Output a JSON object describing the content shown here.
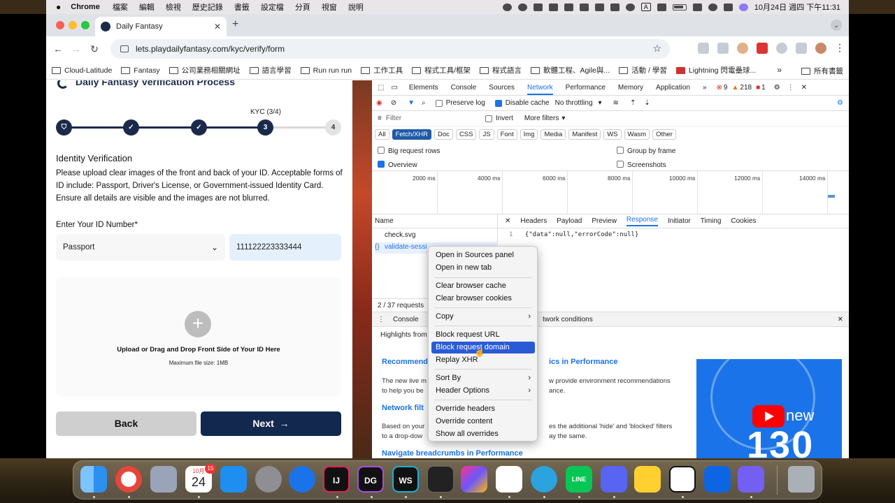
{
  "menubar": {
    "app": "Chrome",
    "items": [
      "檔案",
      "編輯",
      "檢視",
      "歷史記錄",
      "書籤",
      "設定檔",
      "分頁",
      "視窗",
      "說明"
    ],
    "datetime": "10月24日 週四 下午11:31",
    "input_mode": "A"
  },
  "browser": {
    "tab_title": "Daily Fantasy",
    "url": "lets.playdailyfantasy.com/kyc/verify/form",
    "bookmarks": [
      "Cloud-Latitude",
      "Fantasy",
      "公司業務相關網址",
      "語言學習",
      "Run run run",
      "工作工具",
      "程式工具/框架",
      "程式語言",
      "軟體工程、Agile與...",
      "活動 / 學習",
      "Lightning 閃電壘球..."
    ],
    "bookmarks_more": "»",
    "all_bookmarks": "所有書籤"
  },
  "page": {
    "title": "Daily Fantasy Verification Process",
    "kyc_progress": "KYC (3/4)",
    "steps": [
      {
        "label": "✓",
        "done": true
      },
      {
        "label": "✓",
        "done": true
      },
      {
        "label": "✓",
        "done": true
      },
      {
        "label": "3",
        "done": true
      },
      {
        "label": "4",
        "done": false
      }
    ],
    "section_title": "Identity Verification",
    "instructions": "Please upload clear images of the front and back of your ID. Acceptable forms of ID include: Passport, Driver's License, or Government-issued Identity Card. Ensure all details are visible and the images are not blurred.",
    "id_label": "Enter Your ID Number*",
    "id_type": "Passport",
    "id_number": "111122223333444",
    "upload_text": "Upload or Drag and Drop Front Side of Your ID Here",
    "upload_limit": "Maximum file size: 1MB",
    "back_label": "Back",
    "next_label": "Next"
  },
  "devtools": {
    "tabs": [
      "Elements",
      "Console",
      "Sources",
      "Network",
      "Performance",
      "Memory",
      "Application"
    ],
    "active_tab": "Network",
    "errors": "9",
    "warnings": "218",
    "infos": "1",
    "preserve_log": "Preserve log",
    "disable_cache": "Disable cache",
    "throttling": "No throttling",
    "filter_placeholder": "Filter",
    "invert": "Invert",
    "more_filters": "More filters",
    "types": [
      "All",
      "Fetch/XHR",
      "Doc",
      "CSS",
      "JS",
      "Font",
      "Img",
      "Media",
      "Manifest",
      "WS",
      "Wasm",
      "Other"
    ],
    "active_type": "Fetch/XHR",
    "big_rows": "Big request rows",
    "group_by_frame": "Group by frame",
    "overview": "Overview",
    "screenshots": "Screenshots",
    "timeline_labels": [
      "2000 ms",
      "4000 ms",
      "6000 ms",
      "8000 ms",
      "10000 ms",
      "12000 ms",
      "14000 ms"
    ],
    "name_col": "Name",
    "requests": [
      "check.svg",
      "validate-sessi"
    ],
    "detail_tabs": [
      "Headers",
      "Payload",
      "Preview",
      "Response",
      "Initiator",
      "Timing",
      "Cookies"
    ],
    "active_detail": "Response",
    "response_line": "1",
    "response_body": "{\"data\":null,\"errorCode\":null}",
    "status": "2 / 37 requests",
    "drawer_console": "Console",
    "drawer_network_conditions": "twork conditions",
    "drawer_highlights": "Highlights from",
    "whatsnew": {
      "h1": "Recommend",
      "h1b": "ics in Performance",
      "p1a": "The new live m",
      "p1b": "w provide environment recommendations",
      "p1c": "to help you be",
      "p1d": "ance.",
      "h2": "Network filt",
      "p2a": "Based on your",
      "p2b": "es the additional 'hide' and 'blocked' filters",
      "p2c": "to a drop-dow",
      "p2d": "ay the same.",
      "h3": "Navigate breadcrumbs in Performance",
      "thumb_new": "new",
      "thumb_version": "130"
    }
  },
  "context_menu": [
    {
      "label": "Open in Sources panel"
    },
    {
      "label": "Open in new tab"
    },
    {
      "label": "Clear browser cache"
    },
    {
      "label": "Clear browser cookies"
    },
    {
      "label": "Copy",
      "submenu": true
    },
    {
      "label": "Block request URL"
    },
    {
      "label": "Block request domain",
      "selected": true
    },
    {
      "label": "Replay XHR"
    },
    {
      "label": "Sort By",
      "submenu": true
    },
    {
      "label": "Header Options",
      "submenu": true
    },
    {
      "label": "Override headers"
    },
    {
      "label": "Override content"
    },
    {
      "label": "Show all overrides"
    }
  ],
  "dock": {
    "calendar_month": "10月",
    "calendar_day": "24",
    "calendar_badge": "15",
    "apps": [
      "finder-icon",
      "chrome-icon",
      "launchpad-icon",
      "calendar-icon",
      "app-store-icon",
      "system-settings-icon",
      "maps-pin-icon",
      "intellij-icon",
      "datagrip-icon",
      "webstorm-icon",
      "terminal-icon",
      "jetbrains-toolbox-icon",
      "docker-icon",
      "telegram-icon",
      "line-icon",
      "discord-icon",
      "miro-icon",
      "notion-icon",
      "trello-icon",
      "viber-icon",
      "trash-icon"
    ],
    "labels": {
      "intellij": "IJ",
      "datagrip": "DG",
      "webstorm": "WS",
      "line": "LINE"
    }
  },
  "colors": {
    "navy": "#13284f",
    "accent": "#1a73e8",
    "menu_selected": "#2a5bd7"
  }
}
